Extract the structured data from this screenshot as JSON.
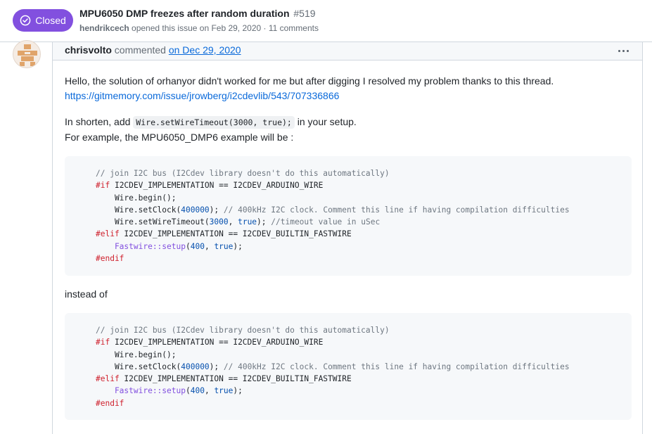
{
  "header": {
    "state": "Closed",
    "title": "MPU6050 DMP freezes after random duration",
    "number": "#519",
    "author": "hendrikcech",
    "meta_text": " opened this issue on Feb 29, 2020 · 11 comments"
  },
  "comment": {
    "author": "chrisvolto",
    "action": " commented ",
    "date": "on Dec 29, 2020",
    "menu_icon": "kebab-horizontal-icon",
    "p1": "Hello, the solution of orhanyor didn't worked for me but after digging I resolved my problem thanks to this thread.",
    "p1_link": "https://gitmemory.com/issue/jrowberg/i2cdevlib/543/707336866",
    "p2_before": "In shorten, add ",
    "p2_code": "Wire.setWireTimeout(3000, true);",
    "p2_after": " in your setup.",
    "p3": "For example, the MPU6050_DMP6 example will be :",
    "instead": "instead of"
  },
  "code1": {
    "l1": "// join I2C bus (I2Cdev library doesn't do this automatically)",
    "l2_kw": "#if",
    "l2_rest": " I2CDEV_IMPLEMENTATION == I2CDEV_ARDUINO_WIRE",
    "l3": "    Wire.begin();",
    "l4_a": "    Wire.setClock(",
    "l4_num": "400000",
    "l4_b": "); ",
    "l4_comment": "// 400kHz I2C clock. Comment this line if having compilation difficulties",
    "l5_a": "    Wire.setWireTimeout(",
    "l5_num": "3000",
    "l5_b": ", ",
    "l5_true": "true",
    "l5_c": "); ",
    "l5_comment": "//timeout value in uSec",
    "l6_kw": "#elif",
    "l6_rest": " I2CDEV_IMPLEMENTATION == I2CDEV_BUILTIN_FASTWIRE",
    "l7_fn": "    Fastwire::setup",
    "l7_a": "(",
    "l7_num": "400",
    "l7_b": ", ",
    "l7_true": "true",
    "l7_c": ");",
    "l8_kw": "#endif"
  },
  "code2": {
    "l1": "// join I2C bus (I2Cdev library doesn't do this automatically)",
    "l2_kw": "#if",
    "l2_rest": " I2CDEV_IMPLEMENTATION == I2CDEV_ARDUINO_WIRE",
    "l3": "    Wire.begin();",
    "l4_a": "    Wire.setClock(",
    "l4_num": "400000",
    "l4_b": "); ",
    "l4_comment": "// 400kHz I2C clock. Comment this line if having compilation difficulties",
    "l5_kw": "#elif",
    "l5_rest": " I2CDEV_IMPLEMENTATION == I2CDEV_BUILTIN_FASTWIRE",
    "l6_fn": "    Fastwire::setup",
    "l6_a": "(",
    "l6_num": "400",
    "l6_b": ", ",
    "l6_true": "true",
    "l6_c": ");",
    "l7_kw": "#endif"
  },
  "colors": {
    "closed_badge": "#8250df",
    "link": "#0969da"
  }
}
